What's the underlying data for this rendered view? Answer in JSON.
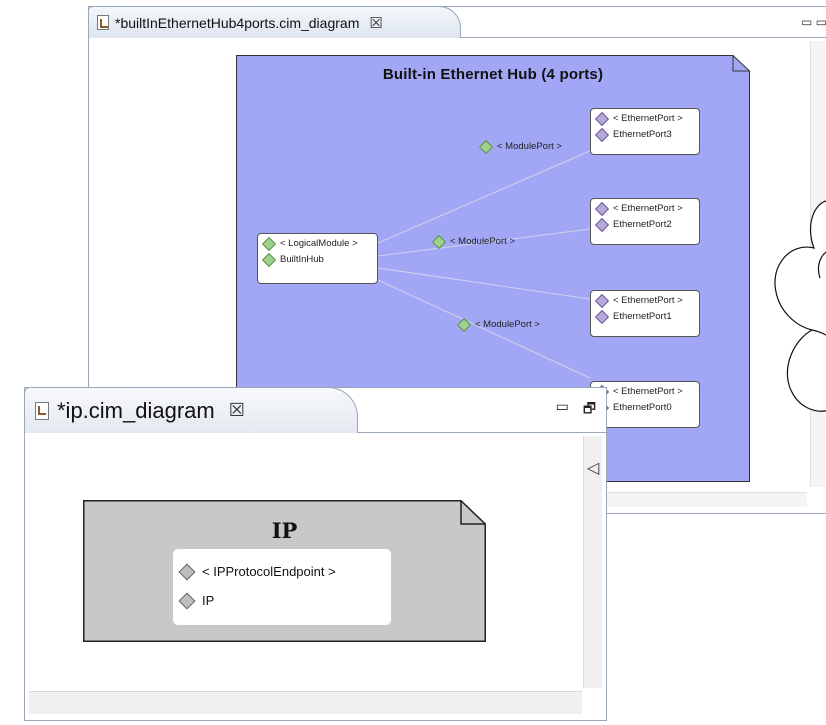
{
  "back_editor": {
    "tab_title": "*builtInEthernetHub4ports.cim_diagram",
    "tab_close": "☒",
    "window_control": "▭ ▭",
    "diagram": {
      "title": "Built-in Ethernet Hub (4 ports)",
      "fill_color": "#a1a7f5",
      "logical_module": {
        "type": "< LogicalModule >",
        "name": "BuiltInHub"
      },
      "edge_labels": [
        "< ModulePort >",
        "< ModulePort >",
        "< ModulePort >"
      ],
      "ports": [
        {
          "type": "< EthernetPort >",
          "name": "EthernetPort3"
        },
        {
          "type": "< EthernetPort >",
          "name": "EthernetPort2"
        },
        {
          "type": "< EthernetPort >",
          "name": "EthernetPort1"
        },
        {
          "type": "< EthernetPort >",
          "name": "EthernetPort0"
        }
      ]
    }
  },
  "front_editor": {
    "tab_title": "*ip.cim_diagram",
    "tab_close": "☒",
    "minimize": "▭",
    "restore": "🗗",
    "scroll_arrow": "◁",
    "diagram": {
      "title": "IP",
      "fill_color": "#c8c8c8",
      "node": {
        "type": "< IPProtocolEndpoint >",
        "name": "IP"
      }
    }
  }
}
